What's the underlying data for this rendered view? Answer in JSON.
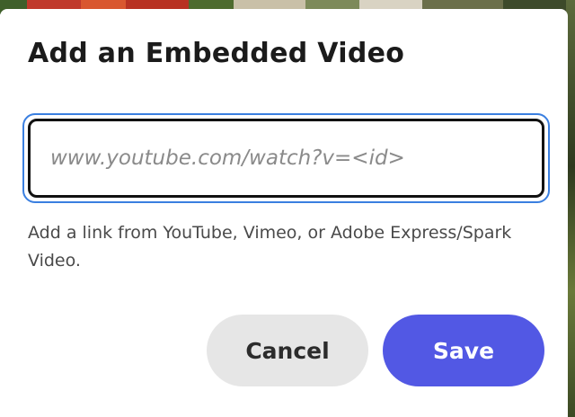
{
  "dialog": {
    "title": "Add an Embedded Video",
    "url_input": {
      "value": "",
      "placeholder": "www.youtube.com/watch?v=<id>"
    },
    "helper_text": "Add a link from YouTube, Vimeo, or Adobe Express/Spark Video.",
    "buttons": {
      "cancel_label": "Cancel",
      "save_label": "Save"
    }
  },
  "colors": {
    "accent_focus_ring": "#3a7fe0",
    "save_button": "#5258e4",
    "cancel_button": "#e6e6e6"
  }
}
